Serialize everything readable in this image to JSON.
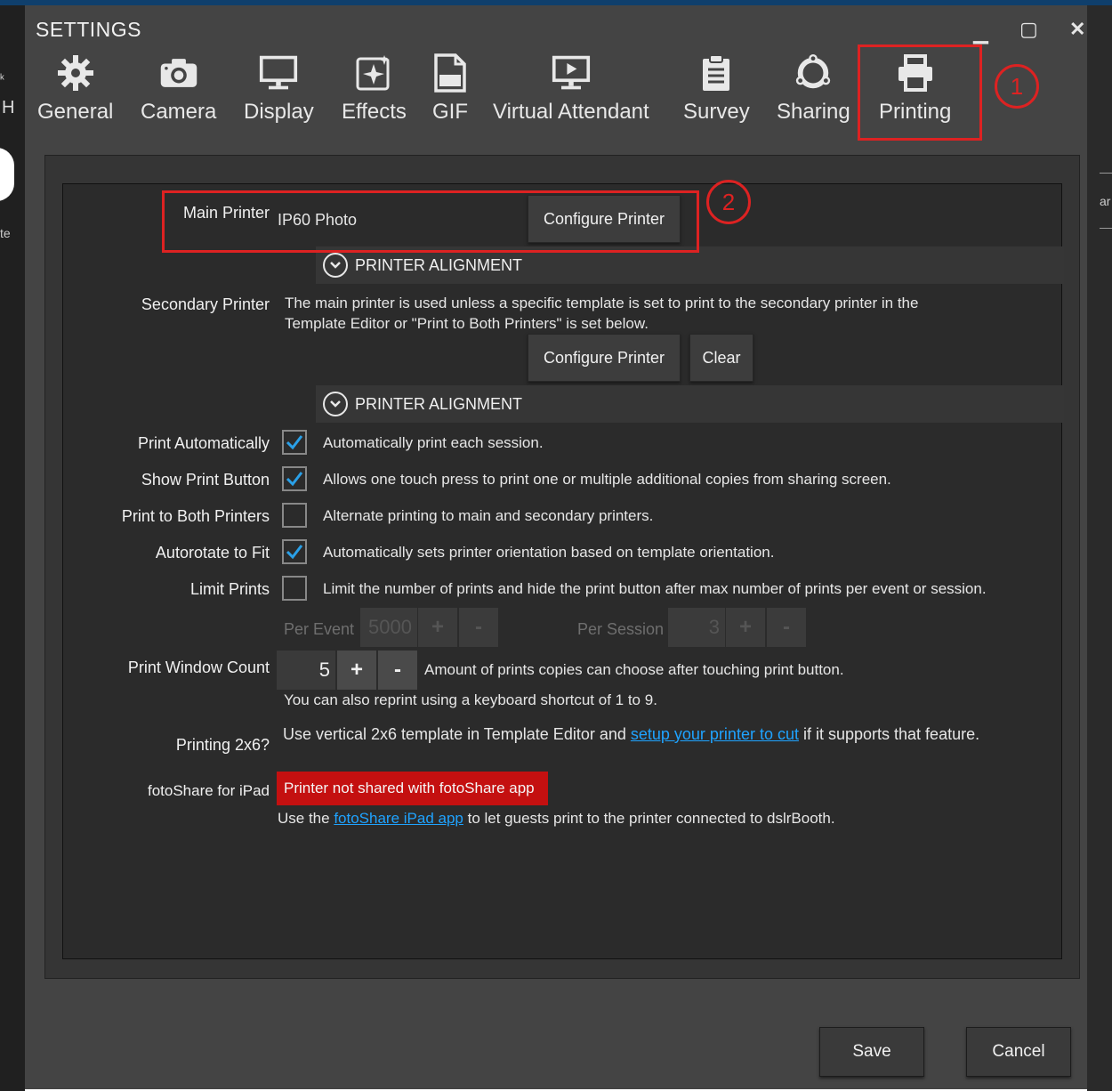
{
  "window": {
    "title": "SETTINGS"
  },
  "window_controls": {
    "minimize": "▁",
    "maximize": "▢",
    "close": "✕"
  },
  "tabs": [
    {
      "label": "General",
      "icon": "gear-icon"
    },
    {
      "label": "Camera",
      "icon": "camera-icon"
    },
    {
      "label": "Display",
      "icon": "monitor-icon"
    },
    {
      "label": "Effects",
      "icon": "sparkle-icon"
    },
    {
      "label": "GIF",
      "icon": "gif-file-icon"
    },
    {
      "label": "Virtual Attendant",
      "icon": "play-monitor-icon"
    },
    {
      "label": "Survey",
      "icon": "clipboard-icon"
    },
    {
      "label": "Sharing",
      "icon": "share-icon"
    },
    {
      "label": "Printing",
      "icon": "printer-icon"
    }
  ],
  "annotations": {
    "one": "1",
    "two": "2"
  },
  "background": {
    "left_chars": [
      "ᵏ",
      "H",
      "te"
    ],
    "right_chars": "ar"
  },
  "main_printer": {
    "label": "Main Printer",
    "value": "IP60 Photo",
    "configure_label": "Configure Printer",
    "alignment_label": "PRINTER ALIGNMENT"
  },
  "secondary_printer": {
    "label": "Secondary Printer",
    "description": "The main printer is used unless a specific template is set to print to the secondary printer in the Template Editor or \"Print to Both Printers\" is set below.",
    "configure_label": "Configure Printer",
    "clear_label": "Clear",
    "alignment_label": "PRINTER ALIGNMENT"
  },
  "options": {
    "print_automatically": {
      "label": "Print Automatically",
      "checked": true,
      "description": "Automatically print each session."
    },
    "show_print_button": {
      "label": "Show Print Button",
      "checked": true,
      "description": "Allows one touch press to print one or multiple additional copies from sharing screen."
    },
    "print_both": {
      "label": "Print to Both Printers",
      "checked": false,
      "description": "Alternate printing to main and secondary printers."
    },
    "autorotate": {
      "label": "Autorotate to Fit",
      "checked": true,
      "description": "Automatically sets printer orientation based on template orientation."
    },
    "limit_prints": {
      "label": "Limit Prints",
      "checked": false,
      "description": "Limit the number of prints and hide the print button after max number of prints per event or session."
    }
  },
  "limits": {
    "per_event_label": "Per Event",
    "per_event_value": "5000",
    "per_session_label": "Per Session",
    "per_session_value": "3",
    "plus": "+",
    "minus": "-"
  },
  "print_window_count": {
    "label": "Print Window Count",
    "value": "5",
    "plus": "+",
    "minus": "-",
    "description": "Amount of prints copies can choose after touching print button.",
    "note": "You can also reprint using a keyboard shortcut of 1 to 9."
  },
  "printing_2x6": {
    "label": "Printing 2x6?",
    "text_before": "Use vertical 2x6 template in Template Editor and ",
    "link": "setup your printer to cut",
    "text_after": " if it supports that feature."
  },
  "fotoshare": {
    "label": "fotoShare for iPad",
    "status": "Printer not shared with fotoShare app",
    "text_before": "Use the ",
    "link": "fotoShare iPad app",
    "text_after": " to let guests print to the printer connected to dslrBooth."
  },
  "footer": {
    "save_label": "Save",
    "cancel_label": "Cancel"
  },
  "colors": {
    "highlight": "#dd2222",
    "link": "#1fa3ff",
    "check": "#2aa0e8",
    "status_red": "#c41010"
  }
}
